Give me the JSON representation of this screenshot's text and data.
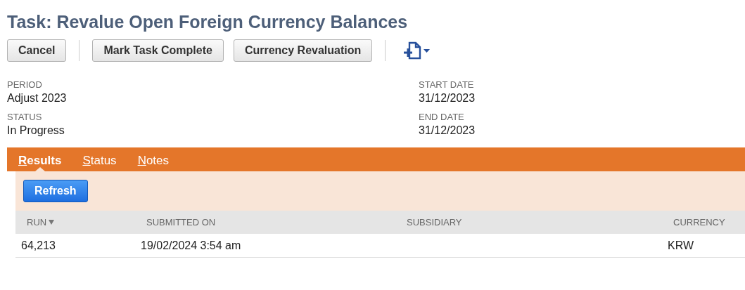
{
  "title": "Task: Revalue Open Foreign Currency Balances",
  "buttons": [
    "Cancel",
    "Mark Task Complete",
    "Currency Revaluation"
  ],
  "fields": [
    {
      "label": "PERIOD",
      "value": "Adjust 2023"
    },
    {
      "label": "START DATE",
      "value": "31/12/2023"
    },
    {
      "label": "STATUS",
      "value": "In Progress"
    },
    {
      "label": "END DATE",
      "value": "31/12/2023"
    }
  ],
  "tabs": [
    {
      "label": "Results",
      "selected": true
    },
    {
      "label": "Status",
      "selected": false
    },
    {
      "label": "Notes",
      "selected": false
    }
  ],
  "refresh_button": "Refresh",
  "table": {
    "columns": [
      {
        "label": "RUN",
        "sorted": true
      },
      {
        "label": "SUBMITTED ON",
        "sorted": false
      },
      {
        "label": "SUBSIDIARY",
        "sorted": false
      },
      {
        "label": "CURRENCY",
        "sorted": false
      }
    ],
    "rows": [
      [
        "64,213",
        "19/02/2024 3:54 am",
        null,
        "KRW"
      ]
    ]
  }
}
